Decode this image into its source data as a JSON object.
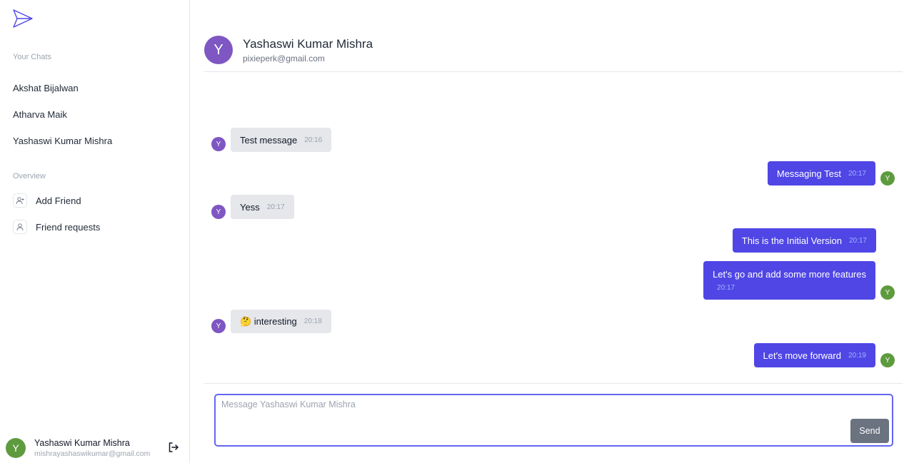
{
  "sidebar": {
    "logo_icon": "paper-plane-icon",
    "chats_label": "Your Chats",
    "chats": [
      "Akshat Bijalwan",
      "Atharva Maik",
      "Yashaswi Kumar Mishra"
    ],
    "overview_label": "Overview",
    "overview": [
      {
        "label": "Add Friend",
        "icon": "user-plus-icon"
      },
      {
        "label": "Friend requests",
        "icon": "user-icon"
      }
    ],
    "profile": {
      "initial": "Y",
      "name": "Yashaswi Kumar Mishra",
      "email": "mishrayashaswikumar@gmail.com",
      "logout_icon": "logout-icon"
    }
  },
  "header": {
    "initial": "Y",
    "name": "Yashaswi Kumar Mishra",
    "email": "pixieperk@gmail.com"
  },
  "messages": [
    {
      "direction": "in",
      "text": "Test message",
      "time": "20:16",
      "avatar": "Y"
    },
    {
      "direction": "out",
      "text": "Messaging Test",
      "time": "20:17",
      "avatar": "Y"
    },
    {
      "direction": "in",
      "text": "Yess",
      "time": "20:17",
      "avatar": "Y"
    },
    {
      "direction": "out",
      "text": "This is the Initial Version",
      "time": "20:17",
      "avatar": ""
    },
    {
      "direction": "out",
      "text": "Let's go and add some more features",
      "time": "20:17",
      "avatar": "Y"
    },
    {
      "direction": "in",
      "text": "🤔 interesting",
      "time": "20:18",
      "avatar": "Y"
    },
    {
      "direction": "out",
      "text": "Let's move forward",
      "time": "20:19",
      "avatar": "Y"
    }
  ],
  "composer": {
    "placeholder": "Message Yashaswi Kumar Mishra",
    "value": "",
    "send_label": "Send"
  },
  "colors": {
    "accent": "#4f46e5",
    "incoming_bubble": "#e5e7eb",
    "avatar_purple": "#7e57c2",
    "avatar_green": "#5d9b3e"
  }
}
